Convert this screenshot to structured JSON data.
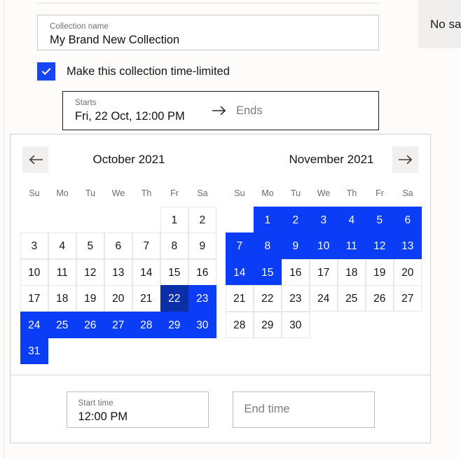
{
  "theme": {
    "accent_blue": "#0a3df5",
    "selected_blue": "#0b2fa8",
    "checkbox_blue": "#1546f0",
    "page_background": "#fdfcfa",
    "panel_background": "#ffffff",
    "side_panel_background": "#f0efee"
  },
  "side_panel": {
    "text": "No sa"
  },
  "collection_name_field": {
    "label": "Collection name",
    "value": "My Brand New Collection"
  },
  "time_limited_checkbox": {
    "label": "Make this collection time-limited",
    "checked": true,
    "icon": "check-icon"
  },
  "range_field": {
    "start_label": "Starts",
    "start_value": "Fri, 22 Oct, 12:00 PM",
    "arrow_icon": "arrow-right-icon",
    "end_placeholder": "Ends"
  },
  "calendar": {
    "prev_icon": "arrow-left-icon",
    "next_icon": "arrow-right-icon",
    "day_names": [
      "Su",
      "Mo",
      "Tu",
      "We",
      "Th",
      "Fr",
      "Sa"
    ],
    "months": [
      {
        "title": "October 2021",
        "first_day_index": 5,
        "num_days": 31,
        "selected_days": [
          22
        ],
        "in_range_days": [
          23,
          24,
          25,
          26,
          27,
          28,
          29,
          30,
          31
        ]
      },
      {
        "title": "November 2021",
        "first_day_index": 1,
        "num_days": 30,
        "selected_days": [],
        "in_range_days": [
          1,
          2,
          3,
          4,
          5,
          6,
          7,
          8,
          9,
          10,
          11,
          12,
          13,
          14,
          15
        ]
      }
    ]
  },
  "time_inputs": {
    "start": {
      "label": "Start time",
      "value": "12:00 PM"
    },
    "end": {
      "placeholder": "End time",
      "value": ""
    }
  }
}
